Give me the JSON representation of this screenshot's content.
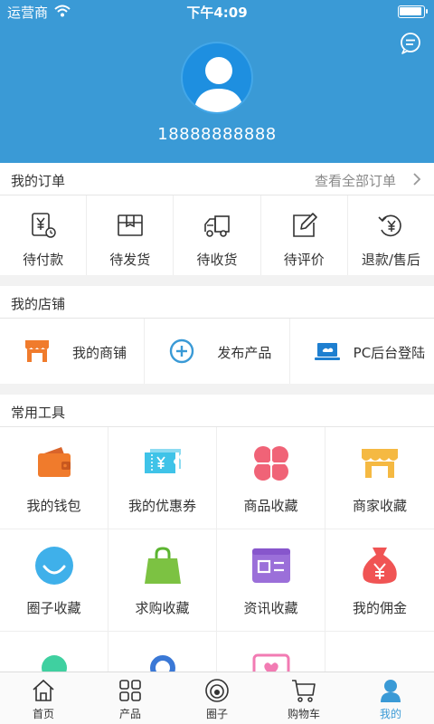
{
  "status_bar": {
    "carrier": "运营商",
    "time": "下午4:09",
    "battery_level": 0.95
  },
  "profile": {
    "phone": "18888888888"
  },
  "orders": {
    "title": "我的订单",
    "view_all": "查看全部订单",
    "items": [
      {
        "label": "待付款",
        "icon": "yen-receipt-icon"
      },
      {
        "label": "待发货",
        "icon": "box-icon"
      },
      {
        "label": "待收货",
        "icon": "truck-icon"
      },
      {
        "label": "待评价",
        "icon": "edit-icon"
      },
      {
        "label": "退款/售后",
        "icon": "refund-icon"
      }
    ]
  },
  "shop": {
    "title": "我的店铺",
    "items": [
      {
        "label": "我的商铺",
        "icon": "store-icon"
      },
      {
        "label": "发布产品",
        "icon": "add-circle-icon"
      },
      {
        "label": "PC后台登陆",
        "icon": "laptop-icon"
      }
    ]
  },
  "tools": {
    "title": "常用工具",
    "items": [
      {
        "label": "我的钱包",
        "icon": "wallet-icon"
      },
      {
        "label": "我的优惠券",
        "icon": "coupon-icon"
      },
      {
        "label": "商品收藏",
        "icon": "clover-icon"
      },
      {
        "label": "商家收藏",
        "icon": "storefront-icon"
      },
      {
        "label": "圈子收藏",
        "icon": "smile-circle-icon"
      },
      {
        "label": "求购收藏",
        "icon": "shopping-bag-icon"
      },
      {
        "label": "资讯收藏",
        "icon": "news-card-icon"
      },
      {
        "label": "我的佣金",
        "icon": "money-bag-icon"
      }
    ]
  },
  "tabbar": {
    "items": [
      {
        "label": "首页",
        "icon": "home-icon"
      },
      {
        "label": "产品",
        "icon": "grid-icon"
      },
      {
        "label": "圈子",
        "icon": "circle-icon"
      },
      {
        "label": "购物车",
        "icon": "cart-icon"
      },
      {
        "label": "我的",
        "icon": "user-icon"
      }
    ],
    "active": "我的"
  },
  "colors": {
    "primary": "#3a9ad6",
    "background": "#f2f2f2"
  }
}
